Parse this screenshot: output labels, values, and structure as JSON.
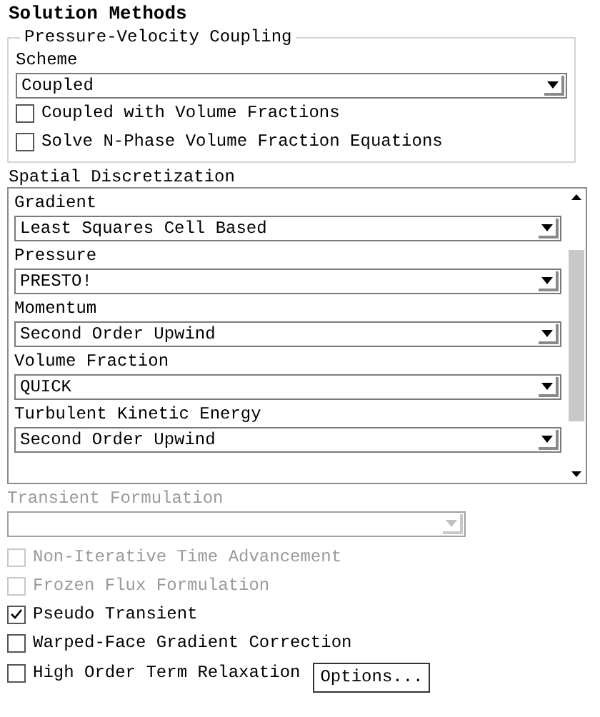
{
  "title": "Solution Methods",
  "pressure_velocity_coupling": {
    "title": "Pressure-Velocity Coupling",
    "scheme_label": "Scheme",
    "scheme": "Coupled",
    "options": [
      {
        "label": "Coupled with Volume Fractions",
        "checked": false
      },
      {
        "label": "Solve N-Phase Volume Fraction Equations",
        "checked": false
      }
    ]
  },
  "spatial_discretization": {
    "title": "Spatial Discretization",
    "fields": [
      {
        "label": "Gradient",
        "value": "Least Squares Cell Based"
      },
      {
        "label": "Pressure",
        "value": "PRESTO!"
      },
      {
        "label": "Momentum",
        "value": "Second Order Upwind"
      },
      {
        "label": "Volume Fraction",
        "value": "QUICK"
      },
      {
        "label": "Turbulent Kinetic Energy",
        "value": "Second Order Upwind"
      }
    ]
  },
  "transient_formulation": {
    "label": "Transient Formulation",
    "disabled": true
  },
  "options": [
    {
      "label": "Non-Iterative Time Advancement",
      "checked": false,
      "disabled": true
    },
    {
      "label": "Frozen Flux Formulation",
      "checked": false,
      "disabled": true
    },
    {
      "label": "Pseudo Transient",
      "checked": true,
      "disabled": false
    },
    {
      "label": "Warped-Face Gradient Correction",
      "checked": false,
      "disabled": false
    },
    {
      "label": "High Order Term Relaxation",
      "checked": false,
      "disabled": false
    }
  ],
  "options_button": "Options..."
}
